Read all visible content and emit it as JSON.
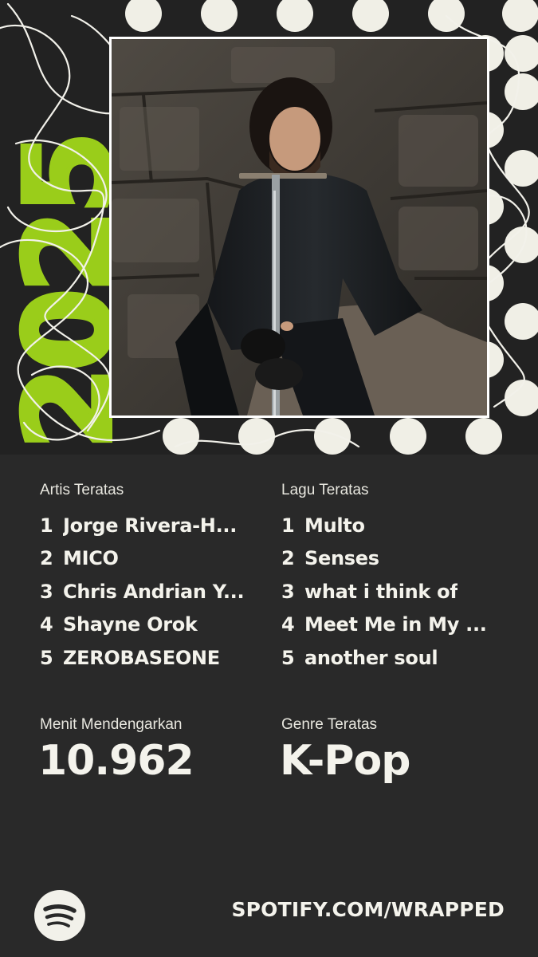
{
  "year": "2025",
  "top_artists": {
    "label": "Artis Teratas",
    "items": [
      {
        "rank": "1",
        "name": "Jorge Rivera-H..."
      },
      {
        "rank": "2",
        "name": "MICO"
      },
      {
        "rank": "3",
        "name": "Chris Andrian Y..."
      },
      {
        "rank": "4",
        "name": "Shayne Orok"
      },
      {
        "rank": "5",
        "name": "ZEROBASEONE"
      }
    ]
  },
  "top_songs": {
    "label": "Lagu Teratas",
    "items": [
      {
        "rank": "1",
        "name": "Multo"
      },
      {
        "rank": "2",
        "name": "Senses"
      },
      {
        "rank": "3",
        "name": "what i think of"
      },
      {
        "rank": "4",
        "name": "Meet Me in My ..."
      },
      {
        "rank": "5",
        "name": "another soul"
      }
    ]
  },
  "minutes": {
    "label": "Menit Mendengarkan",
    "value": "10.962"
  },
  "genre": {
    "label": "Genre Teratas",
    "value": "K-Pop"
  },
  "footer": {
    "url": "SPOTIFY.COM/WRAPPED",
    "logo_icon": "spotify-logo-icon"
  },
  "colors": {
    "accent_green": "#9acd1a",
    "dot_white": "#f0efe6",
    "background": "#292929"
  }
}
